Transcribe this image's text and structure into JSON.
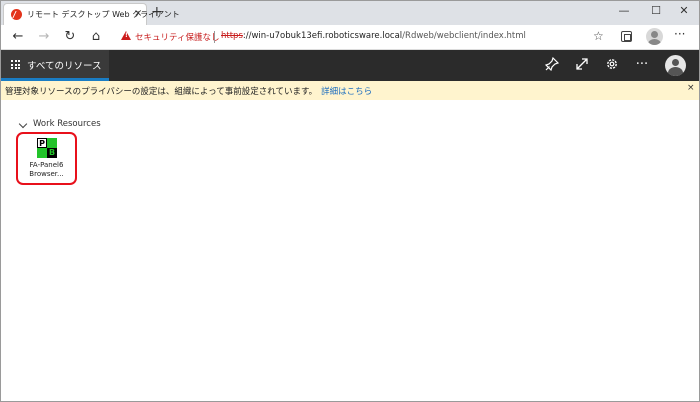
{
  "browser": {
    "tab_title": "リモート デスクトップ Web クライアント",
    "tab_close": "×",
    "new_tab": "+",
    "window_controls": {
      "minimize": "—",
      "maximize": "☐",
      "close": "✕"
    },
    "nav": {
      "back": "←",
      "forward": "→",
      "refresh": "↻",
      "home": "⌂"
    },
    "security_label": "セキュリティ保護なし",
    "url_scheme": "https",
    "url_host": "://win-u7obuk13efi.roboticsware.local",
    "url_path": "/Rdweb/webclient/index.html",
    "favorite_icon": "☆",
    "menu_icon": "···"
  },
  "appbar": {
    "tab_label": "すべてのリソース",
    "icons": [
      "pin-icon",
      "expand-icon",
      "gear-icon",
      "more-icon",
      "user-icon"
    ],
    "more_glyph": "···"
  },
  "notice": {
    "text": "管理対象リソースのプライバシーの設定は、組織によって事前設定されています。",
    "link": "詳細はこちら",
    "close": "×"
  },
  "content": {
    "section_label": "Work Resources",
    "resources": [
      {
        "name": "FA-Panel6 Browser...",
        "icon_letters": [
          "P",
          "B"
        ]
      }
    ]
  },
  "colors": {
    "accent": "#1a7dc4",
    "header_bg": "#2b2b2b",
    "notice_bg": "#fff4ce",
    "highlight_border": "#e8101b",
    "icon_green": "#22c32a"
  }
}
